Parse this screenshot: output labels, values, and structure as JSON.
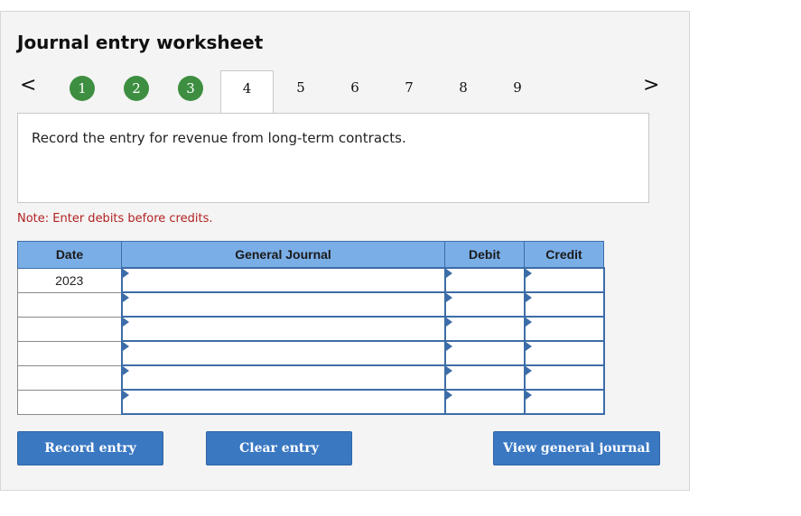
{
  "title": "Journal entry worksheet",
  "nav": {
    "prev": "<",
    "next": ">"
  },
  "steps": [
    {
      "label": "1",
      "status": "complete"
    },
    {
      "label": "2",
      "status": "complete"
    },
    {
      "label": "3",
      "status": "complete"
    },
    {
      "label": "4",
      "status": "active"
    },
    {
      "label": "5",
      "status": "pending"
    },
    {
      "label": "6",
      "status": "pending"
    },
    {
      "label": "7",
      "status": "pending"
    },
    {
      "label": "8",
      "status": "pending"
    },
    {
      "label": "9",
      "status": "pending"
    }
  ],
  "prompt": "Record the entry for revenue from long-term contracts.",
  "note": "Note: Enter debits before credits.",
  "table": {
    "headers": {
      "date": "Date",
      "journal": "General Journal",
      "debit": "Debit",
      "credit": "Credit"
    },
    "rows": [
      {
        "date": "2023",
        "account": "",
        "debit": "",
        "credit": ""
      },
      {
        "date": "",
        "account": "",
        "debit": "",
        "credit": ""
      },
      {
        "date": "",
        "account": "",
        "debit": "",
        "credit": ""
      },
      {
        "date": "",
        "account": "",
        "debit": "",
        "credit": ""
      },
      {
        "date": "",
        "account": "",
        "debit": "",
        "credit": ""
      },
      {
        "date": "",
        "account": "",
        "debit": "",
        "credit": ""
      }
    ]
  },
  "buttons": {
    "record": "Record entry",
    "clear": "Clear entry",
    "view": "View general journal"
  },
  "colors": {
    "step_complete": "#3e8e41",
    "header_bg": "#7aaee7",
    "button_bg": "#3a78c2",
    "note_text": "#b22222"
  }
}
